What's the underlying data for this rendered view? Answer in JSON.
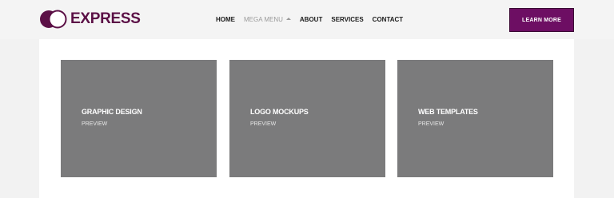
{
  "brand": {
    "name": "EXPRESS",
    "color": "#5b1046"
  },
  "nav": {
    "items": [
      {
        "label": "HOME"
      },
      {
        "label": "MEGA MENU"
      },
      {
        "label": "ABOUT"
      },
      {
        "label": "SERVICES"
      },
      {
        "label": "CONTACT"
      }
    ]
  },
  "cta": {
    "label": "LEARN MORE",
    "color": "#6d0e63"
  },
  "cards": [
    {
      "title": "GRAPHIC DESIGN",
      "subtitle": "PREVIEW"
    },
    {
      "title": "LOGO MOCKUPS",
      "subtitle": "PREVIEW"
    },
    {
      "title": "WEB TEMPLATES",
      "subtitle": "PREVIEW"
    }
  ],
  "colors": {
    "card_bg": "#7b7b7c",
    "header_bg": "#f4f4f4",
    "panel_bg": "#ffffff"
  }
}
